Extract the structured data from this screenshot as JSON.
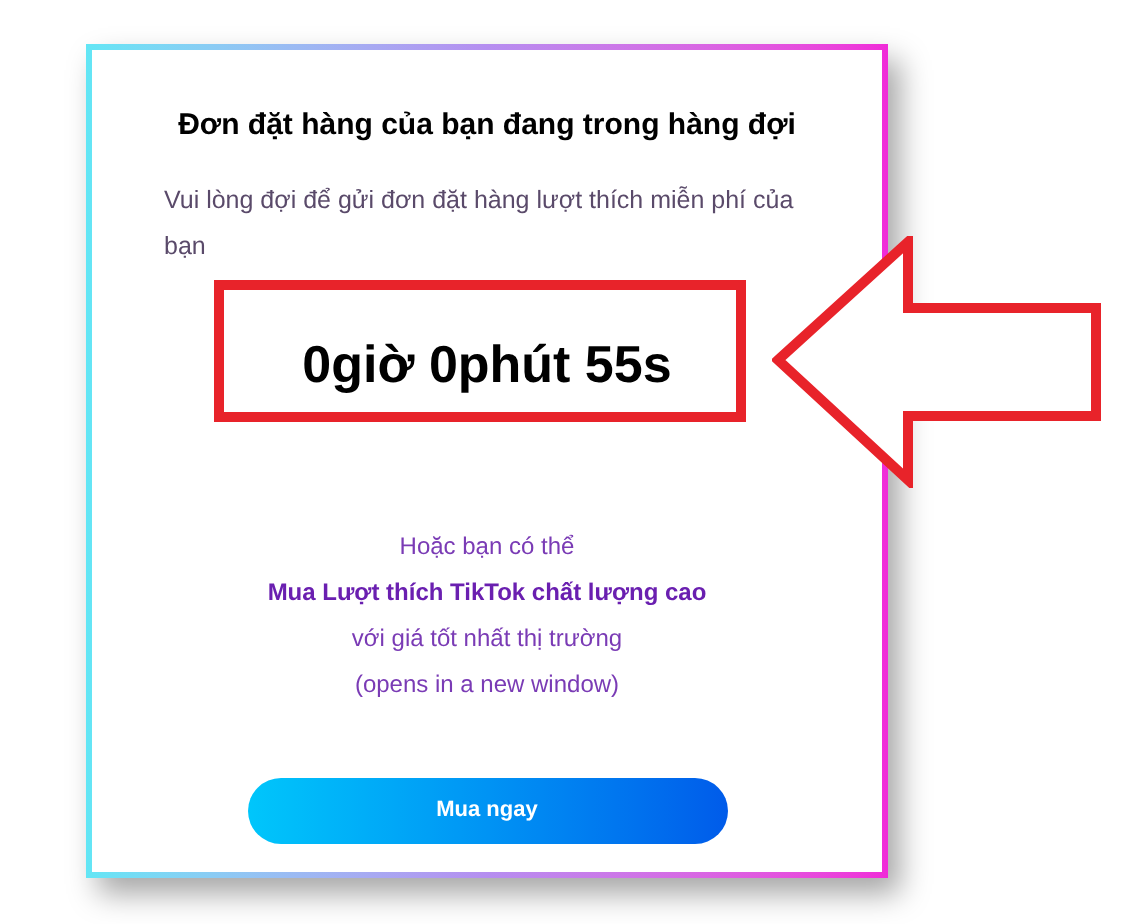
{
  "title": "Đơn đặt hàng của bạn đang trong hàng đợi",
  "subtitle": "Vui lòng đợi để gửi đơn đặt hàng lượt thích miễn phí của bạn",
  "countdown": "0giờ 0phút 55s",
  "offer": {
    "intro": "Hoặc bạn có thể",
    "link": "Mua Lượt thích TikTok chất lượng cao",
    "detail": "với giá tốt nhất thị trường",
    "note": "(opens in a new window)"
  },
  "button": "Mua ngay"
}
